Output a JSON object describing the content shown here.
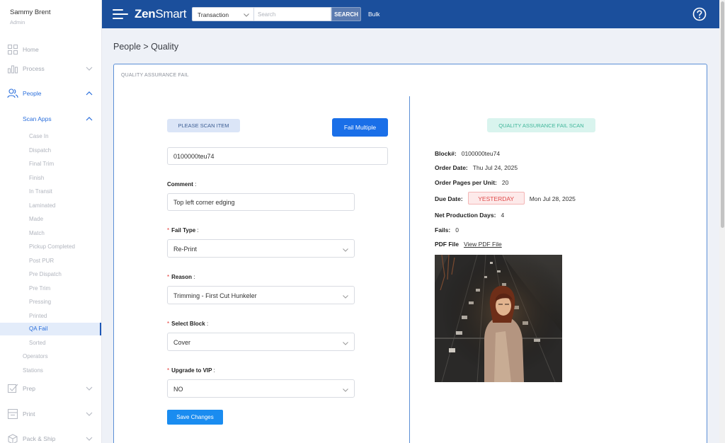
{
  "user": {
    "name": "Sammy Brent",
    "role": "Admin"
  },
  "sidebar": {
    "nav": [
      {
        "label": "Home",
        "icon": "grid-icon"
      },
      {
        "label": "Process",
        "icon": "chart-icon"
      },
      {
        "label": "People",
        "icon": "people-icon"
      },
      {
        "label": "Scan Apps"
      }
    ],
    "sub_items": [
      "Case In",
      "Dispatch",
      "Final Trim",
      "Finish",
      "In Transit",
      "Laminated",
      "Made",
      "Match",
      "Pickup Completed",
      "Post PUR",
      "Pre Dispatch",
      "Pre Trim",
      "Pressing",
      "Printed",
      "QA Fail",
      "Sorted"
    ],
    "more": [
      "Operators",
      "Stations"
    ],
    "bottom": [
      {
        "label": "Prep",
        "icon": "checklist-icon"
      },
      {
        "label": "Print",
        "icon": "printer-icon"
      },
      {
        "label": "Pack & Ship",
        "icon": "box-icon"
      }
    ]
  },
  "topbar": {
    "logo_prefix": "Zen",
    "logo_suffix": "Smart",
    "search_type": "Transaction",
    "search_placeholder": "Search",
    "search_button": "SEARCH",
    "bulk": "Bulk"
  },
  "breadcrumb": "People > Quality",
  "card": {
    "title": "QUALITY ASSURANCE FAIL",
    "scan_pill": "PLEASE SCAN ITEM",
    "fail_multiple": "Fail Multiple",
    "scan_value": "0100000teu74",
    "comment_label": "Comment",
    "comment_value": "Top left corner edging",
    "fail_type_label": "Fail Type",
    "fail_type_value": "Re-Print",
    "reason_label": "Reason",
    "reason_value": "Trimming - First Cut Hunkeler",
    "select_block_label": "Select Block",
    "select_block_value": "Cover",
    "upgrade_label": "Upgrade to VIP",
    "upgrade_value": "NO",
    "save": "Save Changes",
    "colon": ":",
    "required": "*"
  },
  "panel": {
    "title": "QUALITY ASSURANCE FAIL SCAN",
    "block_label": "Block#:",
    "block_value": "0100000teu74",
    "order_date_label": "Order Date:",
    "order_date_value": "Thu Jul 24, 2025",
    "pages_label": "Order Pages per Unit:",
    "pages_value": "20",
    "due_label": "Due Date:",
    "due_badge": "YESTERDAY",
    "due_value": "Mon Jul 28, 2025",
    "net_label": "Net Production Days:",
    "net_value": "4",
    "fails_label": "Fails:",
    "fails_value": "0",
    "pdf_label": "PDF File",
    "pdf_link": "View PDF File"
  },
  "colors": {
    "topbar": "#1b4f9c",
    "primary": "#1a6fe8",
    "accent_bar": "#1f59b7",
    "danger": "#e04a4a",
    "success": "#3fb69a"
  }
}
